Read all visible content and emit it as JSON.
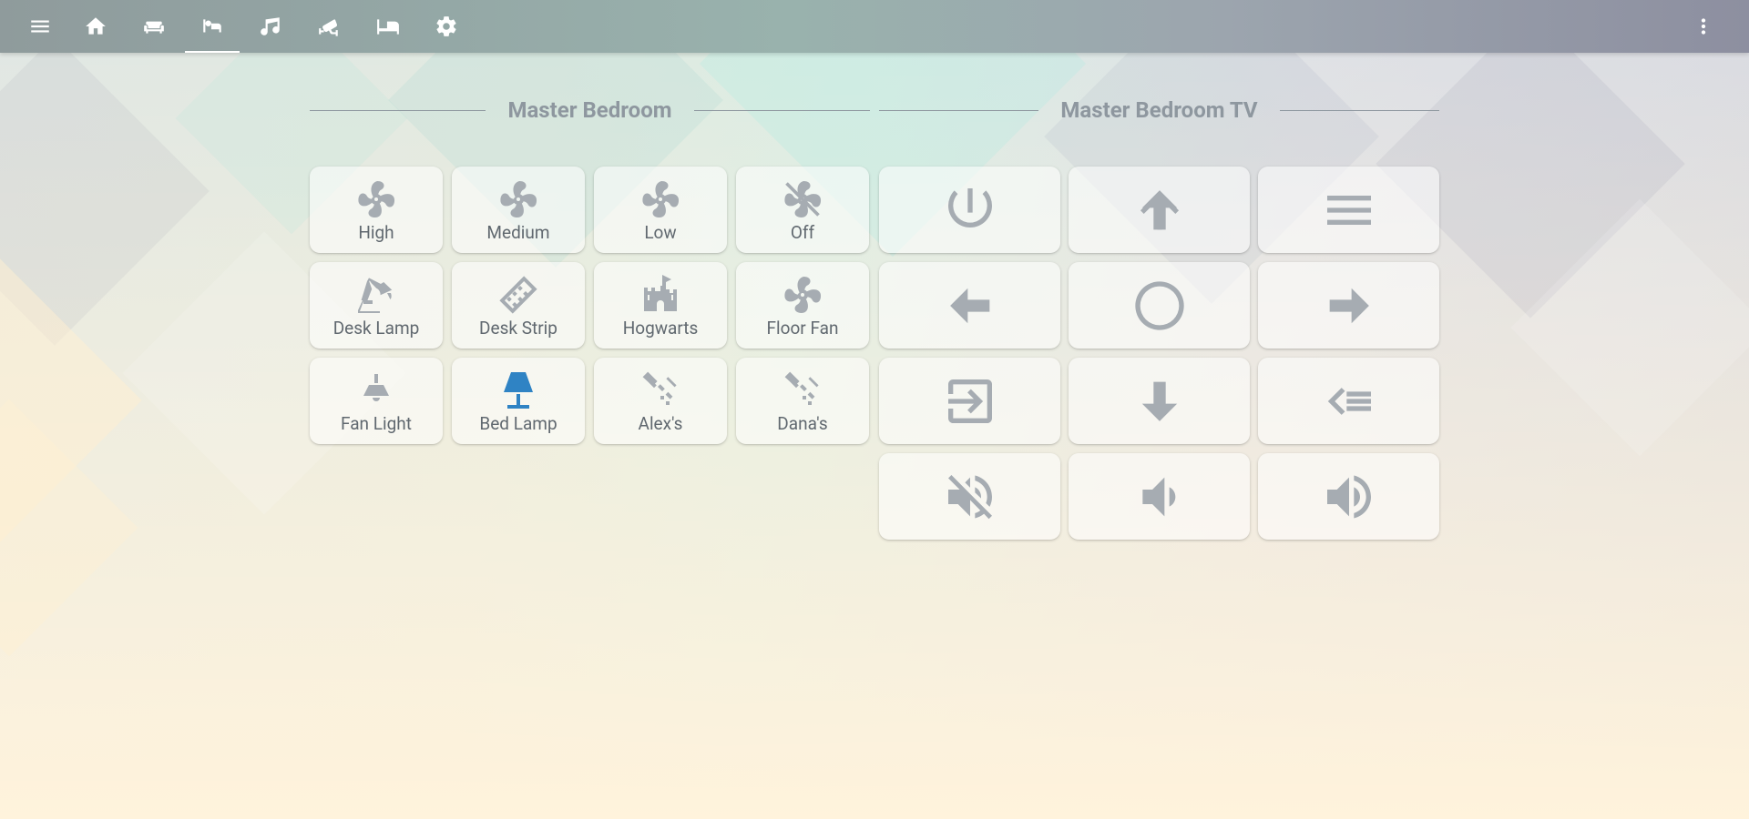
{
  "toolbar": {
    "menu_icon": "menu-icon",
    "tabs": [
      {
        "icon": "home-icon"
      },
      {
        "icon": "sofa-icon"
      },
      {
        "icon": "bed-icon",
        "active": true
      },
      {
        "icon": "music-icon"
      },
      {
        "icon": "cctv-icon"
      },
      {
        "icon": "bed-empty-icon"
      },
      {
        "icon": "gear-icon"
      }
    ],
    "overflow_icon": "dots-vertical-icon"
  },
  "sections": {
    "bedroom_title": "Master Bedroom",
    "tv_title": "Master Bedroom TV"
  },
  "bedroom_tiles": [
    {
      "label": "High",
      "icon": "fan-icon"
    },
    {
      "label": "Medium",
      "icon": "fan-icon"
    },
    {
      "label": "Low",
      "icon": "fan-icon"
    },
    {
      "label": "Off",
      "icon": "fan-off-icon"
    },
    {
      "label": "Desk Lamp",
      "icon": "desk-lamp-icon"
    },
    {
      "label": "Desk Strip",
      "icon": "led-strip-icon"
    },
    {
      "label": "Hogwarts",
      "icon": "castle-icon"
    },
    {
      "label": "Floor Fan",
      "icon": "fan-icon"
    },
    {
      "label": "Fan Light",
      "icon": "ceiling-light-icon"
    },
    {
      "label": "Bed Lamp",
      "icon": "lamp-icon",
      "state": "on"
    },
    {
      "label": "Alex's",
      "icon": "spotlight-icon"
    },
    {
      "label": "Dana's",
      "icon": "spotlight-icon"
    }
  ],
  "tv_tiles": [
    {
      "icon": "power-icon"
    },
    {
      "icon": "arrow-up-icon"
    },
    {
      "icon": "menu-lines-icon"
    },
    {
      "icon": "arrow-left-icon"
    },
    {
      "icon": "circle-select-icon"
    },
    {
      "icon": "arrow-right-icon"
    },
    {
      "icon": "input-icon"
    },
    {
      "icon": "arrow-down-icon"
    },
    {
      "icon": "back-icon"
    },
    {
      "icon": "volume-mute-icon"
    },
    {
      "icon": "volume-down-icon"
    },
    {
      "icon": "volume-up-icon"
    }
  ],
  "colors": {
    "accent_on": "#2f83c4",
    "icon_off": "#a6acb2",
    "section_title": "#8e979f"
  }
}
